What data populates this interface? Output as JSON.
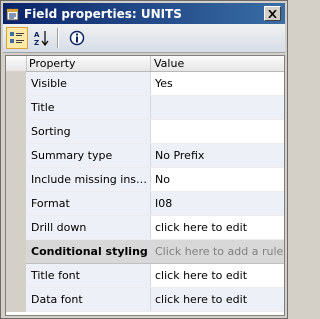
{
  "window": {
    "title": "Field properties: UNITS",
    "close_symbol": "✕"
  },
  "toolbar": {
    "buttons": [
      {
        "name": "categorized-icon",
        "active": true
      },
      {
        "name": "sort-az-icon",
        "active": false
      },
      {
        "name": "info-icon",
        "active": false
      }
    ]
  },
  "grid": {
    "headers": {
      "property": "Property",
      "value": "Value"
    },
    "rows": [
      {
        "property": "Visible",
        "value": "Yes",
        "alt": false
      },
      {
        "property": "Title",
        "value": "",
        "alt": true
      },
      {
        "property": "Sorting",
        "value": "",
        "alt": false
      },
      {
        "property": "Summary type",
        "value": "No Prefix",
        "alt": true
      },
      {
        "property": "Include missing instan...",
        "value": "No",
        "alt": false
      },
      {
        "property": "Format",
        "value": "I08",
        "alt": true
      },
      {
        "property": "Drill down",
        "value": "click here to edit",
        "alt": false
      },
      {
        "property": "Conditional styling",
        "value": "Click here to add a rule",
        "group": true
      },
      {
        "property": "Title font",
        "value": "click here to edit",
        "alt": false
      },
      {
        "property": "Data font",
        "value": "click here to edit",
        "alt": true
      }
    ]
  }
}
